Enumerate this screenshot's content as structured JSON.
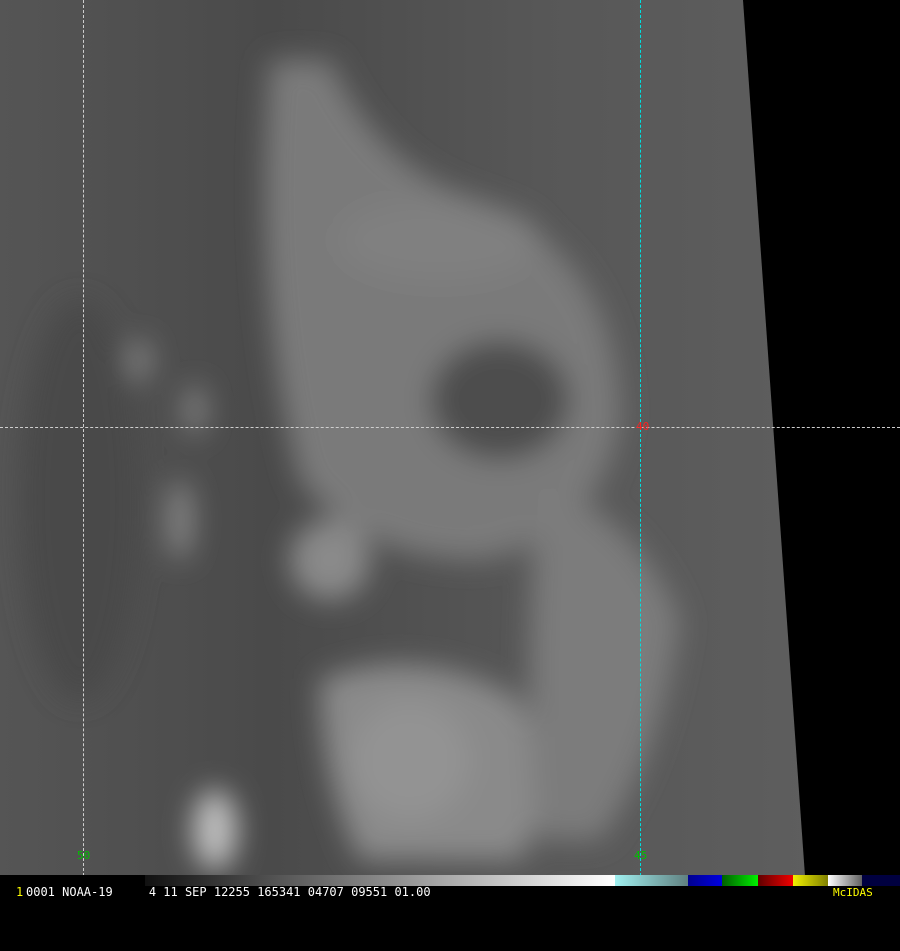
{
  "footer": {
    "frame_number": "1",
    "info": "0001 NOAA-19     4 11 SEP 12255 165341 04707 09551 01.00",
    "brand": "McIDAS"
  },
  "grid_labels": {
    "lon_west": "50",
    "lon_east": "45",
    "lat": "40"
  },
  "colors": {
    "grid_white": "#cfcfcf",
    "grid_cyan": "#00e0e0",
    "lon_label": "#00c000",
    "lat_label": "#ff2020",
    "brand": "#ffff00",
    "frame_number": "#ffff00"
  }
}
